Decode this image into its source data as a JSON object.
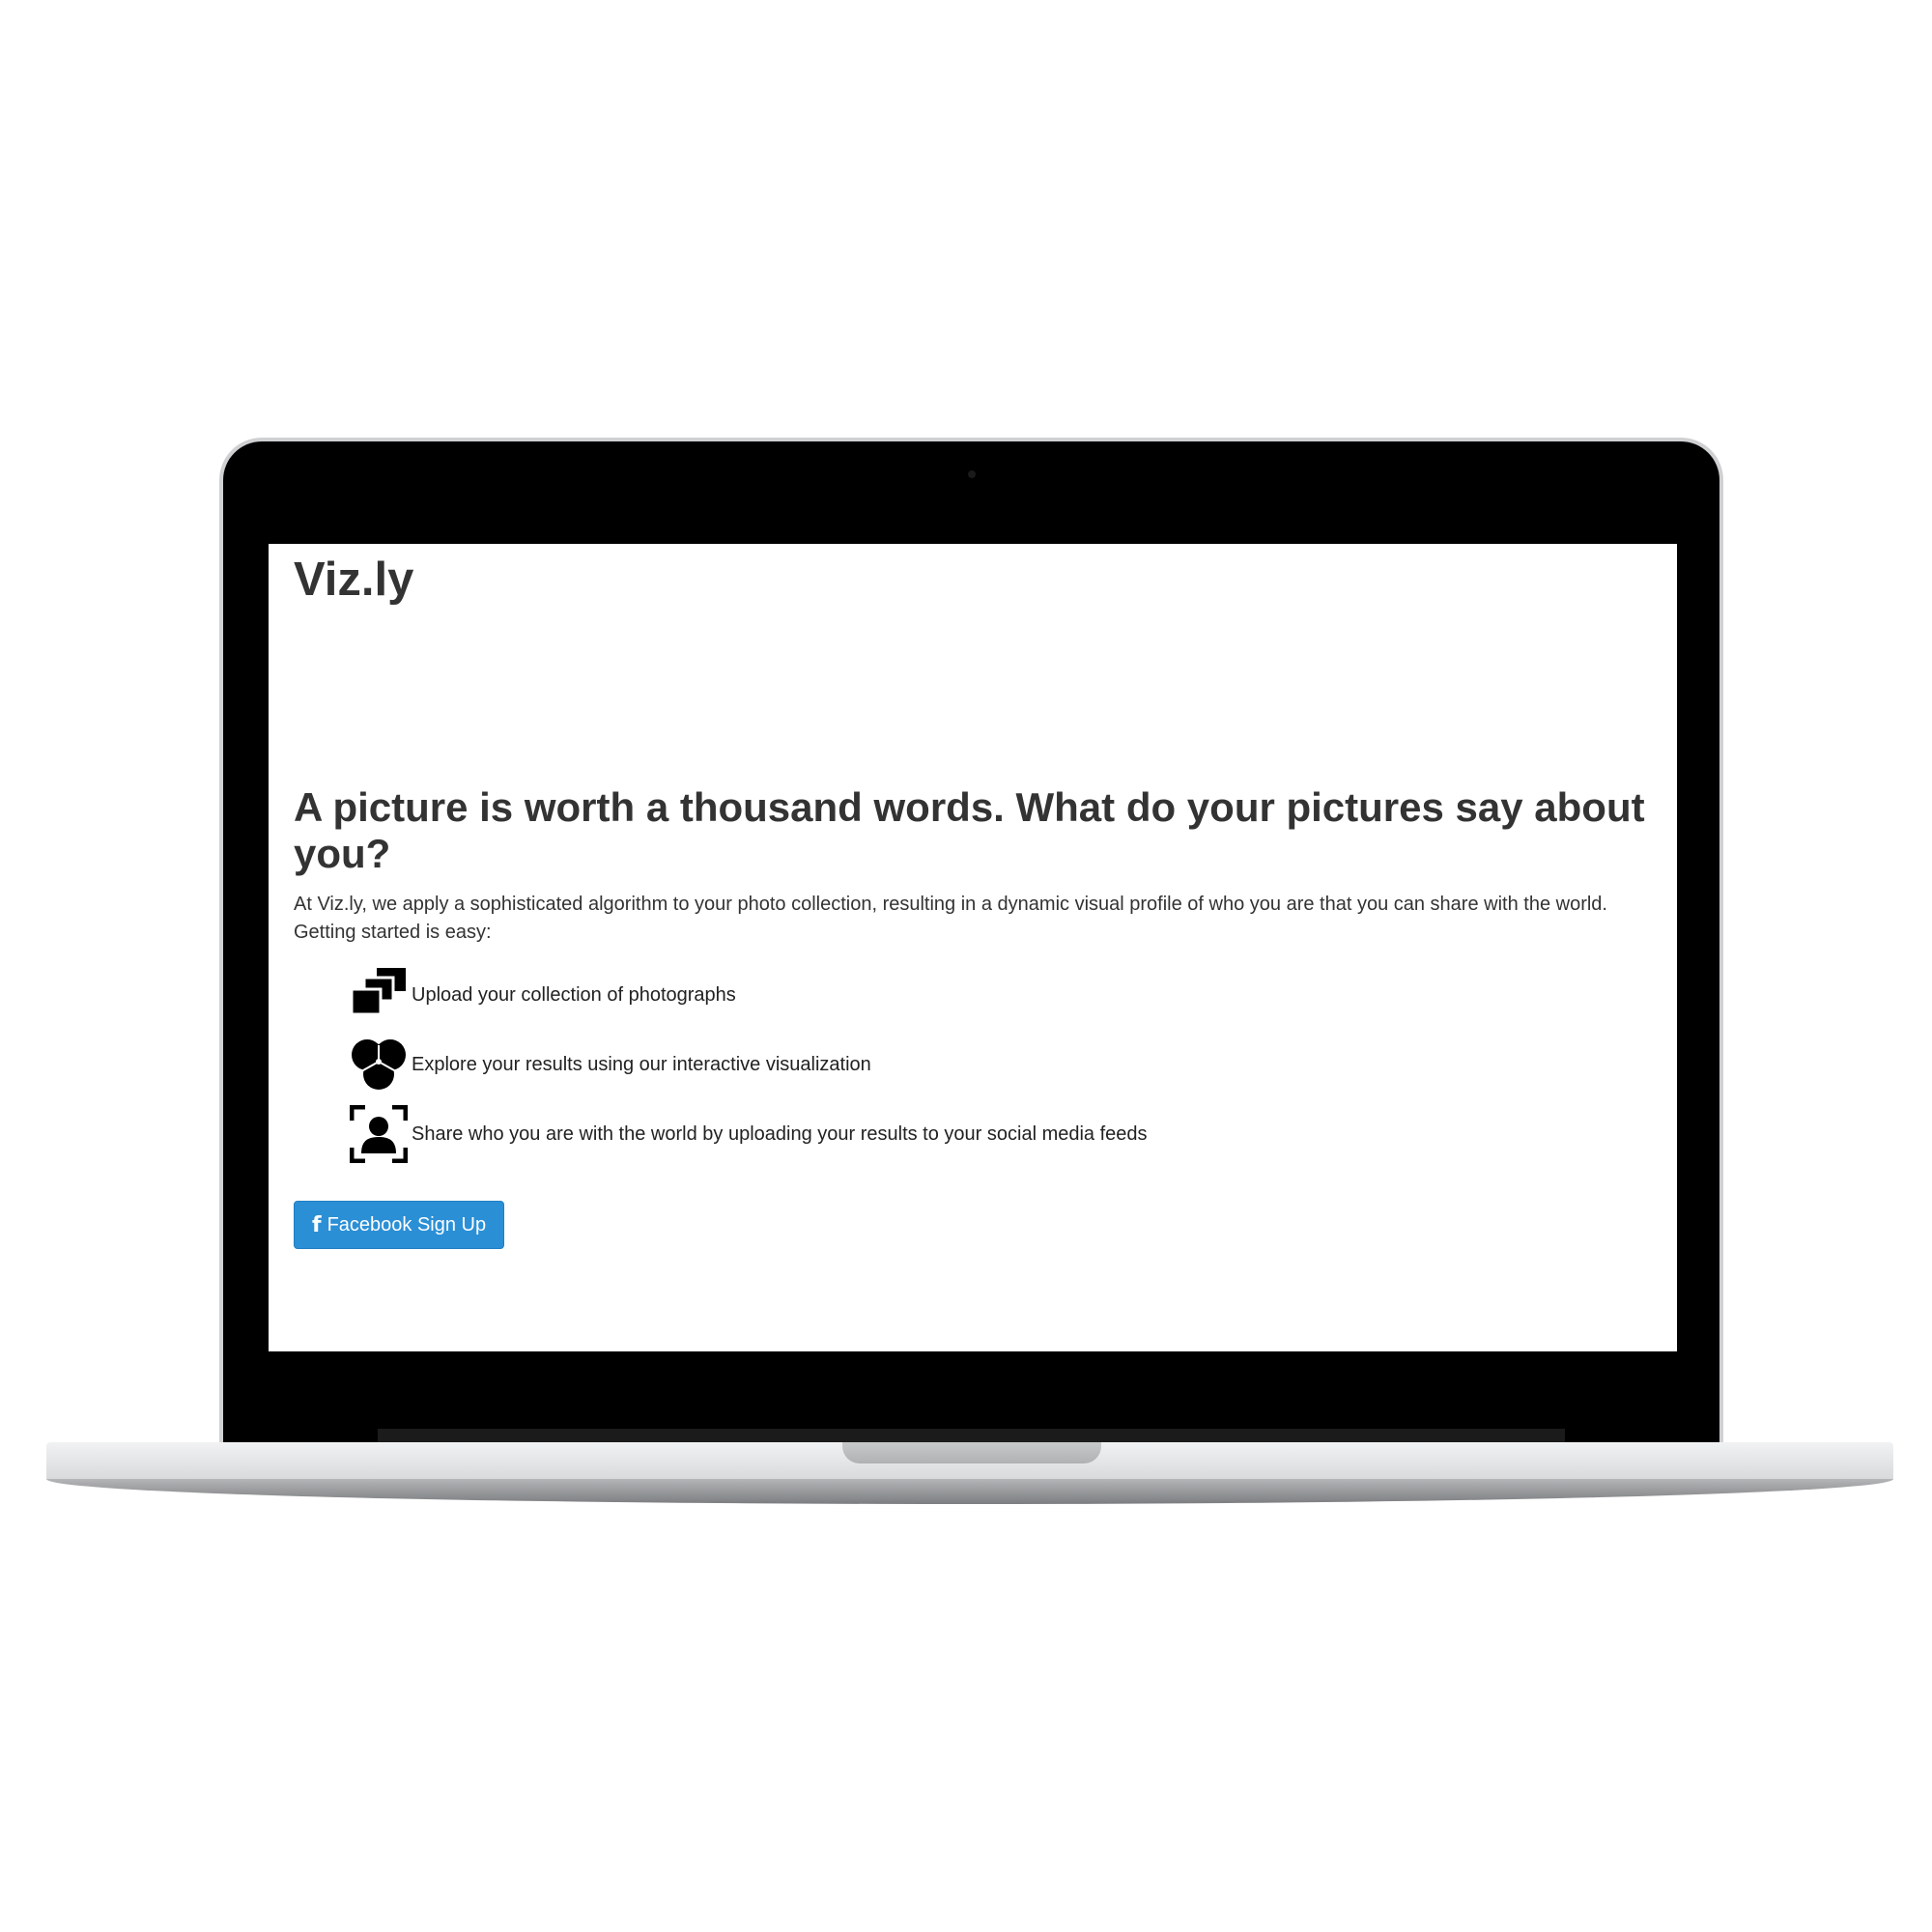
{
  "site": {
    "brand": "Viz.ly"
  },
  "hero": {
    "headline": "A picture is worth a thousand words. What do your pictures say about you?",
    "intro": "At Viz.ly, we apply a sophisticated algorithm to your photo collection, resulting in a dynamic visual profile of who you are that you can share with the world. Getting started is easy:"
  },
  "steps": [
    {
      "icon": "photo-stack-icon",
      "label": "Upload your collection of photographs"
    },
    {
      "icon": "venn-circles-icon",
      "label": "Explore your results using our interactive visualization"
    },
    {
      "icon": "profile-frame-icon",
      "label": "Share who you are with the world by uploading your results to your social media feeds"
    }
  ],
  "signup": {
    "icon": "facebook-icon",
    "icon_glyph": "f",
    "label": "Facebook Sign Up"
  },
  "colors": {
    "button": "#2b8fd6",
    "text": "#333333",
    "bezel": "#000000"
  }
}
